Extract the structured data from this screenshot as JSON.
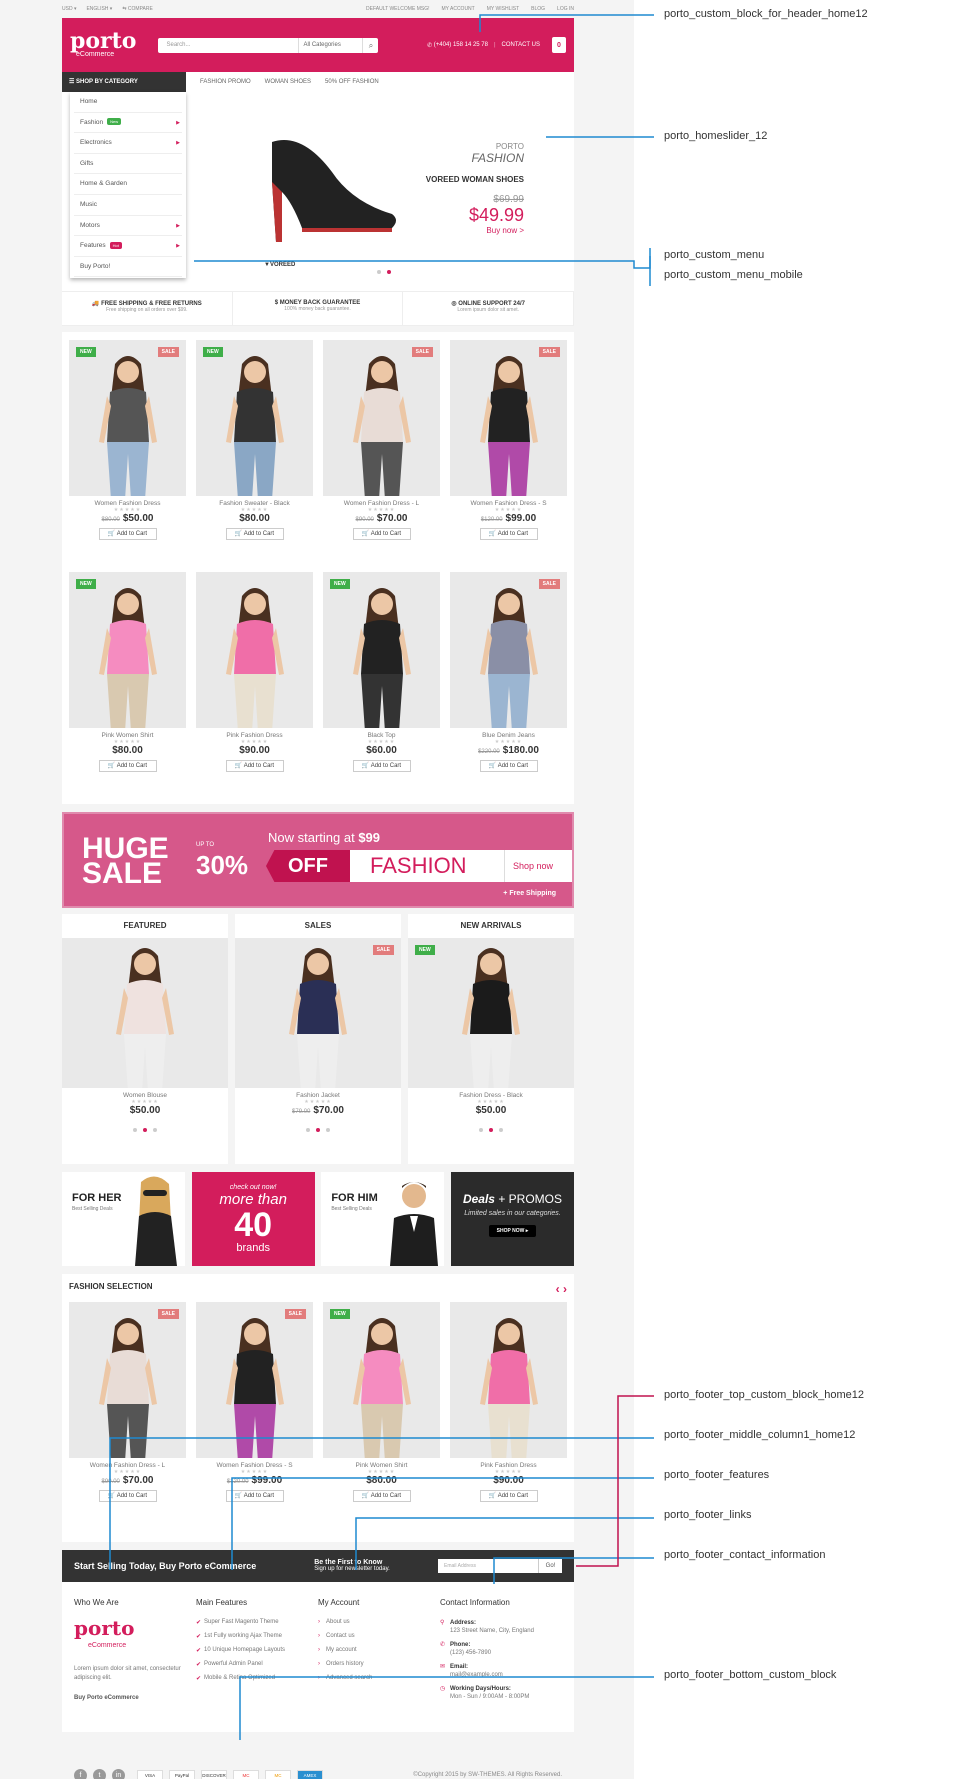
{
  "topbar": {
    "currency": "USD ▾",
    "language": "ENGLISH ▾",
    "compare": "COMPARE",
    "welcome": "DEFAULT WELCOME MSG!",
    "account": "MY ACCOUNT",
    "wishlist": "MY WISHLIST",
    "blog": "BLOG",
    "login": "LOG IN"
  },
  "header": {
    "logo": "porto",
    "logo_sub": "eCommerce",
    "search_placeholder": "Search...",
    "search_category": "All Categories",
    "phone": "(+404) 158 14 25 78",
    "contact": "CONTACT US",
    "cart_count": "0"
  },
  "nav": {
    "shop_by_category": "SHOP BY CATEGORY",
    "links": [
      "FASHION PROMO",
      "WOMAN SHOES",
      "50% OFF FASHION"
    ]
  },
  "categories": [
    {
      "label": "Home"
    },
    {
      "label": "Fashion",
      "badge": "New",
      "arrow": true
    },
    {
      "label": "Electronics",
      "arrow": true
    },
    {
      "label": "Gifts"
    },
    {
      "label": "Home & Garden"
    },
    {
      "label": "Music"
    },
    {
      "label": "Motors",
      "arrow": true
    },
    {
      "label": "Features",
      "badge": "Hot",
      "arrow": true
    },
    {
      "label": "Buy Porto!"
    }
  ],
  "slider": {
    "brand": "PORTO",
    "title": "FASHION",
    "product": "VOREED WOMAN SHOES",
    "old_price": "$69.99",
    "price": "$49.99",
    "buy": "Buy now >",
    "shoe_brand": "▼VOREED"
  },
  "features": [
    {
      "title": "FREE SHIPPING & FREE RETURNS",
      "sub": "Free shipping on all orders over $99."
    },
    {
      "title": "MONEY BACK GUARANTEE",
      "sub": "100% money back guarantee."
    },
    {
      "title": "ONLINE SUPPORT 24/7",
      "sub": "Lorem ipsum dolor sit amet."
    }
  ],
  "products": [
    {
      "name": "Women Fashion Dress",
      "old": "$80.00",
      "price": "$50.00",
      "new": true,
      "sale": true,
      "top": "#555",
      "bottom": "#9bb5d1"
    },
    {
      "name": "Fashion Sweater - Black",
      "old": "",
      "price": "$80.00",
      "new": true,
      "sale": false,
      "top": "#333",
      "bottom": "#8aa7c5"
    },
    {
      "name": "Women Fashion Dress - L",
      "old": "$90.00",
      "price": "$70.00",
      "new": false,
      "sale": true,
      "top": "#e8dcd6",
      "bottom": "#555"
    },
    {
      "name": "Women Fashion Dress - S",
      "old": "$120.00",
      "price": "$99.00",
      "new": false,
      "sale": true,
      "top": "#222",
      "bottom": "#b04aa8"
    },
    {
      "name": "Pink Women Shirt",
      "old": "",
      "price": "$80.00",
      "new": true,
      "sale": false,
      "top": "#f58cc0",
      "bottom": "#d9c9b0"
    },
    {
      "name": "Pink Fashion Dress",
      "old": "",
      "price": "$90.00",
      "new": false,
      "sale": false,
      "top": "#f06ea8",
      "bottom": "#e8e0d0"
    },
    {
      "name": "Black Top",
      "old": "",
      "price": "$60.00",
      "new": true,
      "sale": false,
      "top": "#222",
      "bottom": "#333"
    },
    {
      "name": "Blue Denim Jeans",
      "old": "$220.00",
      "price": "$180.00",
      "new": false,
      "sale": true,
      "top": "#8a8fa6",
      "bottom": "#9bb5d1"
    }
  ],
  "labels": {
    "new": "NEW",
    "sale": "SALE",
    "add_to_cart": "Add to Cart",
    "stars": "★★★★★"
  },
  "banner": {
    "huge": "HUGE",
    "sale": "SALE",
    "up_to": "UP TO",
    "percent": "30%",
    "starting": "Now starting at",
    "starting_price": "$99",
    "off": "OFF",
    "fashion": "FASHION",
    "shop_now": "Shop now",
    "free_shipping": "+ Free Shipping"
  },
  "trio": [
    {
      "title": "FEATURED",
      "name": "Women Blouse",
      "old": "",
      "price": "$50.00",
      "label": "",
      "top": "#efe2df",
      "bottom": "#eee"
    },
    {
      "title": "SALES",
      "name": "Fashion Jacket",
      "old": "$79.00",
      "price": "$70.00",
      "label": "SALE",
      "top": "#2a2f55",
      "bottom": "#eee"
    },
    {
      "title": "NEW ARRIVALS",
      "name": "Fashion Dress - Black",
      "old": "",
      "price": "$50.00",
      "label": "NEW",
      "top": "#1b1b1b",
      "bottom": "#eee"
    }
  ],
  "promos": {
    "her_title": "FOR HER",
    "her_sub": "Best Selling Deals",
    "check": "check out now!",
    "more": "more than",
    "forty": "40",
    "brands": "brands",
    "him_title": "FOR HIM",
    "him_sub": "Best Selling Deals",
    "deals": "Deals",
    "promos": "+ PROMOS",
    "limited": "Limited sales in our categories.",
    "shop_now": "SHOP NOW ▸"
  },
  "fashion_selection": {
    "title": "FASHION SELECTION",
    "arrows": "‹ ›",
    "items": [
      {
        "name": "Women Fashion Dress - L",
        "old": "$90.00",
        "price": "$70.00",
        "new": false,
        "sale": true,
        "top": "#e8dcd6",
        "bottom": "#555"
      },
      {
        "name": "Women Fashion Dress - S",
        "old": "$120.00",
        "price": "$99.00",
        "new": false,
        "sale": true,
        "top": "#222",
        "bottom": "#b04aa8"
      },
      {
        "name": "Pink Women Shirt",
        "old": "",
        "price": "$80.00",
        "new": true,
        "sale": false,
        "top": "#f58cc0",
        "bottom": "#d9c9b0"
      },
      {
        "name": "Pink Fashion Dress",
        "old": "",
        "price": "$90.00",
        "new": false,
        "sale": false,
        "top": "#f06ea8",
        "bottom": "#e8e0d0"
      }
    ]
  },
  "newsletter": {
    "start": "Start Selling Today, Buy Porto eCommerce",
    "know": "Be the First to Know",
    "signup": "Sign up for newsletter today.",
    "email_placeholder": "Email Address",
    "go": "Go!"
  },
  "footer": {
    "who_title": "Who We Are",
    "who_text": "Lorem ipsum dolor sit amet, consectetur adipiscing elit.",
    "buy": "Buy Porto eCommerce",
    "main_title": "Main Features",
    "main": [
      "Super Fast Magento Theme",
      "1st Fully working Ajax Theme",
      "10 Unique Homepage Layouts",
      "Powerful Admin Panel",
      "Mobile & Retina Optimized"
    ],
    "account_title": "My Account",
    "account": [
      "About us",
      "Contact us",
      "My account",
      "Orders history",
      "Advanced search"
    ],
    "contact_title": "Contact Information",
    "contact": [
      {
        "k": "Address:",
        "v": "123 Street Name, City, England"
      },
      {
        "k": "Phone:",
        "v": "(123) 456-7890"
      },
      {
        "k": "Email:",
        "v": "mail@example.com"
      },
      {
        "k": "Working Days/Hours:",
        "v": "Mon - Sun / 9:00AM - 8:00PM"
      }
    ]
  },
  "bottom": {
    "social": [
      "f",
      "t",
      "in"
    ],
    "payments": [
      "VISA",
      "PayPal",
      "DISCOVER",
      "MC",
      "MC",
      "AMEX"
    ],
    "copyright": "©Copyright 2015 by SW-THEMES. All Rights Reserved."
  },
  "annotations": [
    "porto_custom_block_for_header_home12",
    "porto_homeslider_12",
    "porto_custom_menu",
    "porto_custom_menu_mobile",
    "porto_footer_top_custom_block_home12",
    "porto_footer_middle_column1_home12",
    "porto_footer_features",
    "porto_footer_links",
    "porto_footer_contact_information",
    "porto_footer_bottom_custom_block"
  ],
  "colors": {
    "brand": "#d31d5c",
    "annotation_line": "#1e8ad0",
    "annotation_line_red": "#c0124f"
  }
}
